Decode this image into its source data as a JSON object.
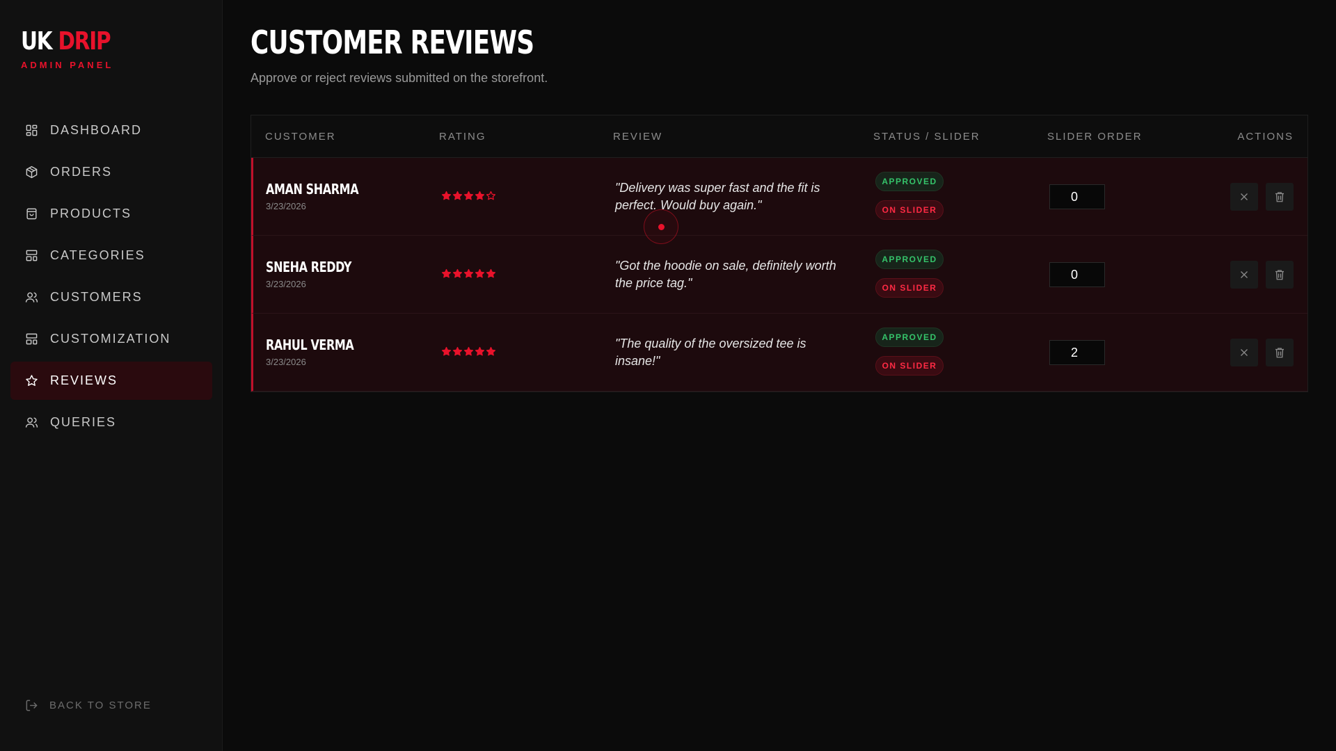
{
  "brand": {
    "title_white": "UK ",
    "title_red": "DRIP",
    "subtitle": "ADMIN PANEL",
    "accent": "#e8122b"
  },
  "sidebar": {
    "items": [
      {
        "label": "DASHBOARD",
        "icon": "dashboard-icon",
        "active": false
      },
      {
        "label": "ORDERS",
        "icon": "package-icon",
        "active": false
      },
      {
        "label": "PRODUCTS",
        "icon": "shopping-bag-icon",
        "active": false
      },
      {
        "label": "CATEGORIES",
        "icon": "layout-icon",
        "active": false
      },
      {
        "label": "CUSTOMERS",
        "icon": "users-icon",
        "active": false
      },
      {
        "label": "CUSTOMIZATION",
        "icon": "layout-icon",
        "active": false
      },
      {
        "label": "REVIEWS",
        "icon": "star-icon",
        "active": true
      },
      {
        "label": "QUERIES",
        "icon": "users-icon",
        "active": false
      }
    ],
    "back_label": "BACK TO STORE"
  },
  "page": {
    "title": "CUSTOMER REVIEWS",
    "subtitle": "Approve or reject reviews submitted on the storefront."
  },
  "table": {
    "headers": {
      "customer": "CUSTOMER",
      "rating": "RATING",
      "review": "REVIEW",
      "status": "STATUS / SLIDER",
      "order": "SLIDER ORDER",
      "actions": "ACTIONS"
    },
    "rows": [
      {
        "name": "AMAN SHARMA",
        "date": "3/23/2026",
        "rating": 4,
        "review": "\"Delivery was super fast and the fit is perfect. Would buy again.\"",
        "status": "APPROVED",
        "slider": "ON SLIDER",
        "order": "0"
      },
      {
        "name": "SNEHA REDDY",
        "date": "3/23/2026",
        "rating": 5,
        "review": "\"Got the hoodie on sale, definitely worth the price tag.\"",
        "status": "APPROVED",
        "slider": "ON SLIDER",
        "order": "0"
      },
      {
        "name": "RAHUL VERMA",
        "date": "3/23/2026",
        "rating": 5,
        "review": "\"The quality of the oversized tee is insane!\"",
        "status": "APPROVED",
        "slider": "ON SLIDER",
        "order": "2"
      }
    ]
  },
  "colors": {
    "approved": "#35c36a",
    "slider": "#ff2a44",
    "row_bg": "#1d0a0d"
  }
}
